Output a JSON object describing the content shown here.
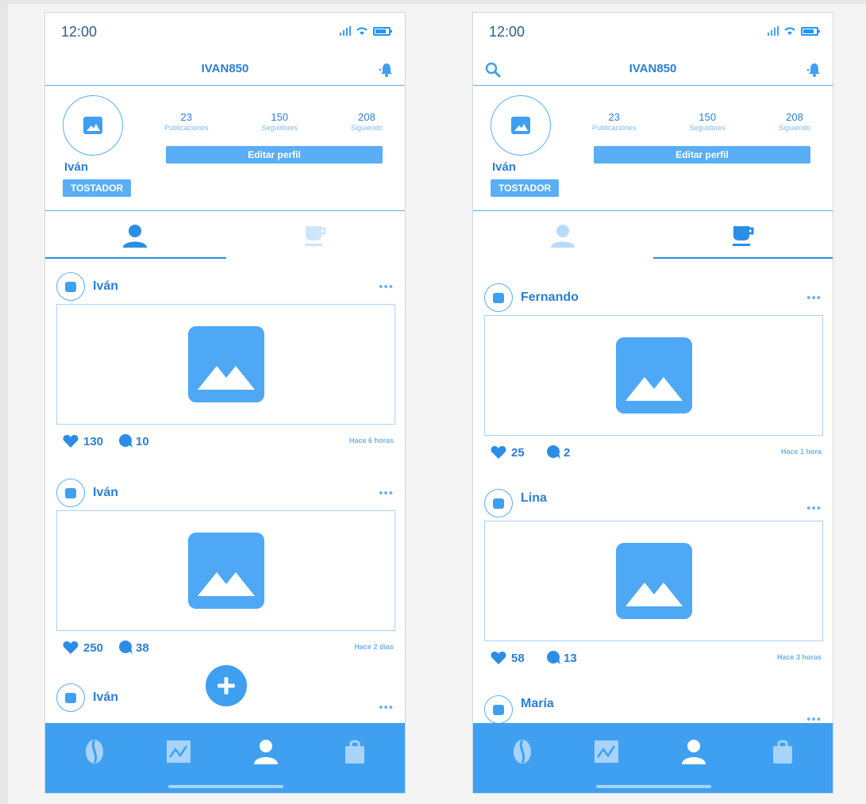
{
  "screens": [
    {
      "status": {
        "time": "12:00"
      },
      "header": {
        "username": "IVAN850"
      },
      "profile": {
        "name": "Iván",
        "badge": "TOSTADOR",
        "stats": [
          {
            "value": "23",
            "label": "Publicaciones"
          },
          {
            "value": "150",
            "label": "Seguidores"
          },
          {
            "value": "208",
            "label": "Siguiendo"
          }
        ],
        "edit_label": "Editar perfil"
      },
      "tabs": {
        "active": "user"
      },
      "posts": [
        {
          "author": "Iván",
          "likes": "130",
          "comments": "10",
          "time": "Hace 6 horas"
        },
        {
          "author": "Iván",
          "likes": "250",
          "comments": "38",
          "time": "Hace 2 días"
        },
        {
          "author": "Iván"
        }
      ]
    },
    {
      "status": {
        "time": "12:00"
      },
      "header": {
        "username": "IVAN850"
      },
      "profile": {
        "name": "Iván",
        "badge": "TOSTADOR",
        "stats": [
          {
            "value": "23",
            "label": "Publicaciones"
          },
          {
            "value": "150",
            "label": "Seguidores"
          },
          {
            "value": "208",
            "label": "Siguiendo"
          }
        ],
        "edit_label": "Editar perfil"
      },
      "tabs": {
        "active": "coffee"
      },
      "posts": [
        {
          "author": "Fernando",
          "likes": "25",
          "comments": "2",
          "time": "Hace 1 hora"
        },
        {
          "author": "Lina",
          "likes": "58",
          "comments": "13",
          "time": "Hace 3 horas"
        },
        {
          "author": "María"
        }
      ]
    }
  ],
  "colors": {
    "accent": "#3fa0f2",
    "text": "#2b7fd3",
    "light": "#a9d1f7"
  },
  "icons": {
    "bell": "bell-icon",
    "search": "search-icon",
    "fab": "plus-icon",
    "nav": [
      "coffee-bean-icon",
      "chart-icon",
      "user-icon",
      "shopping-bag-icon"
    ]
  }
}
